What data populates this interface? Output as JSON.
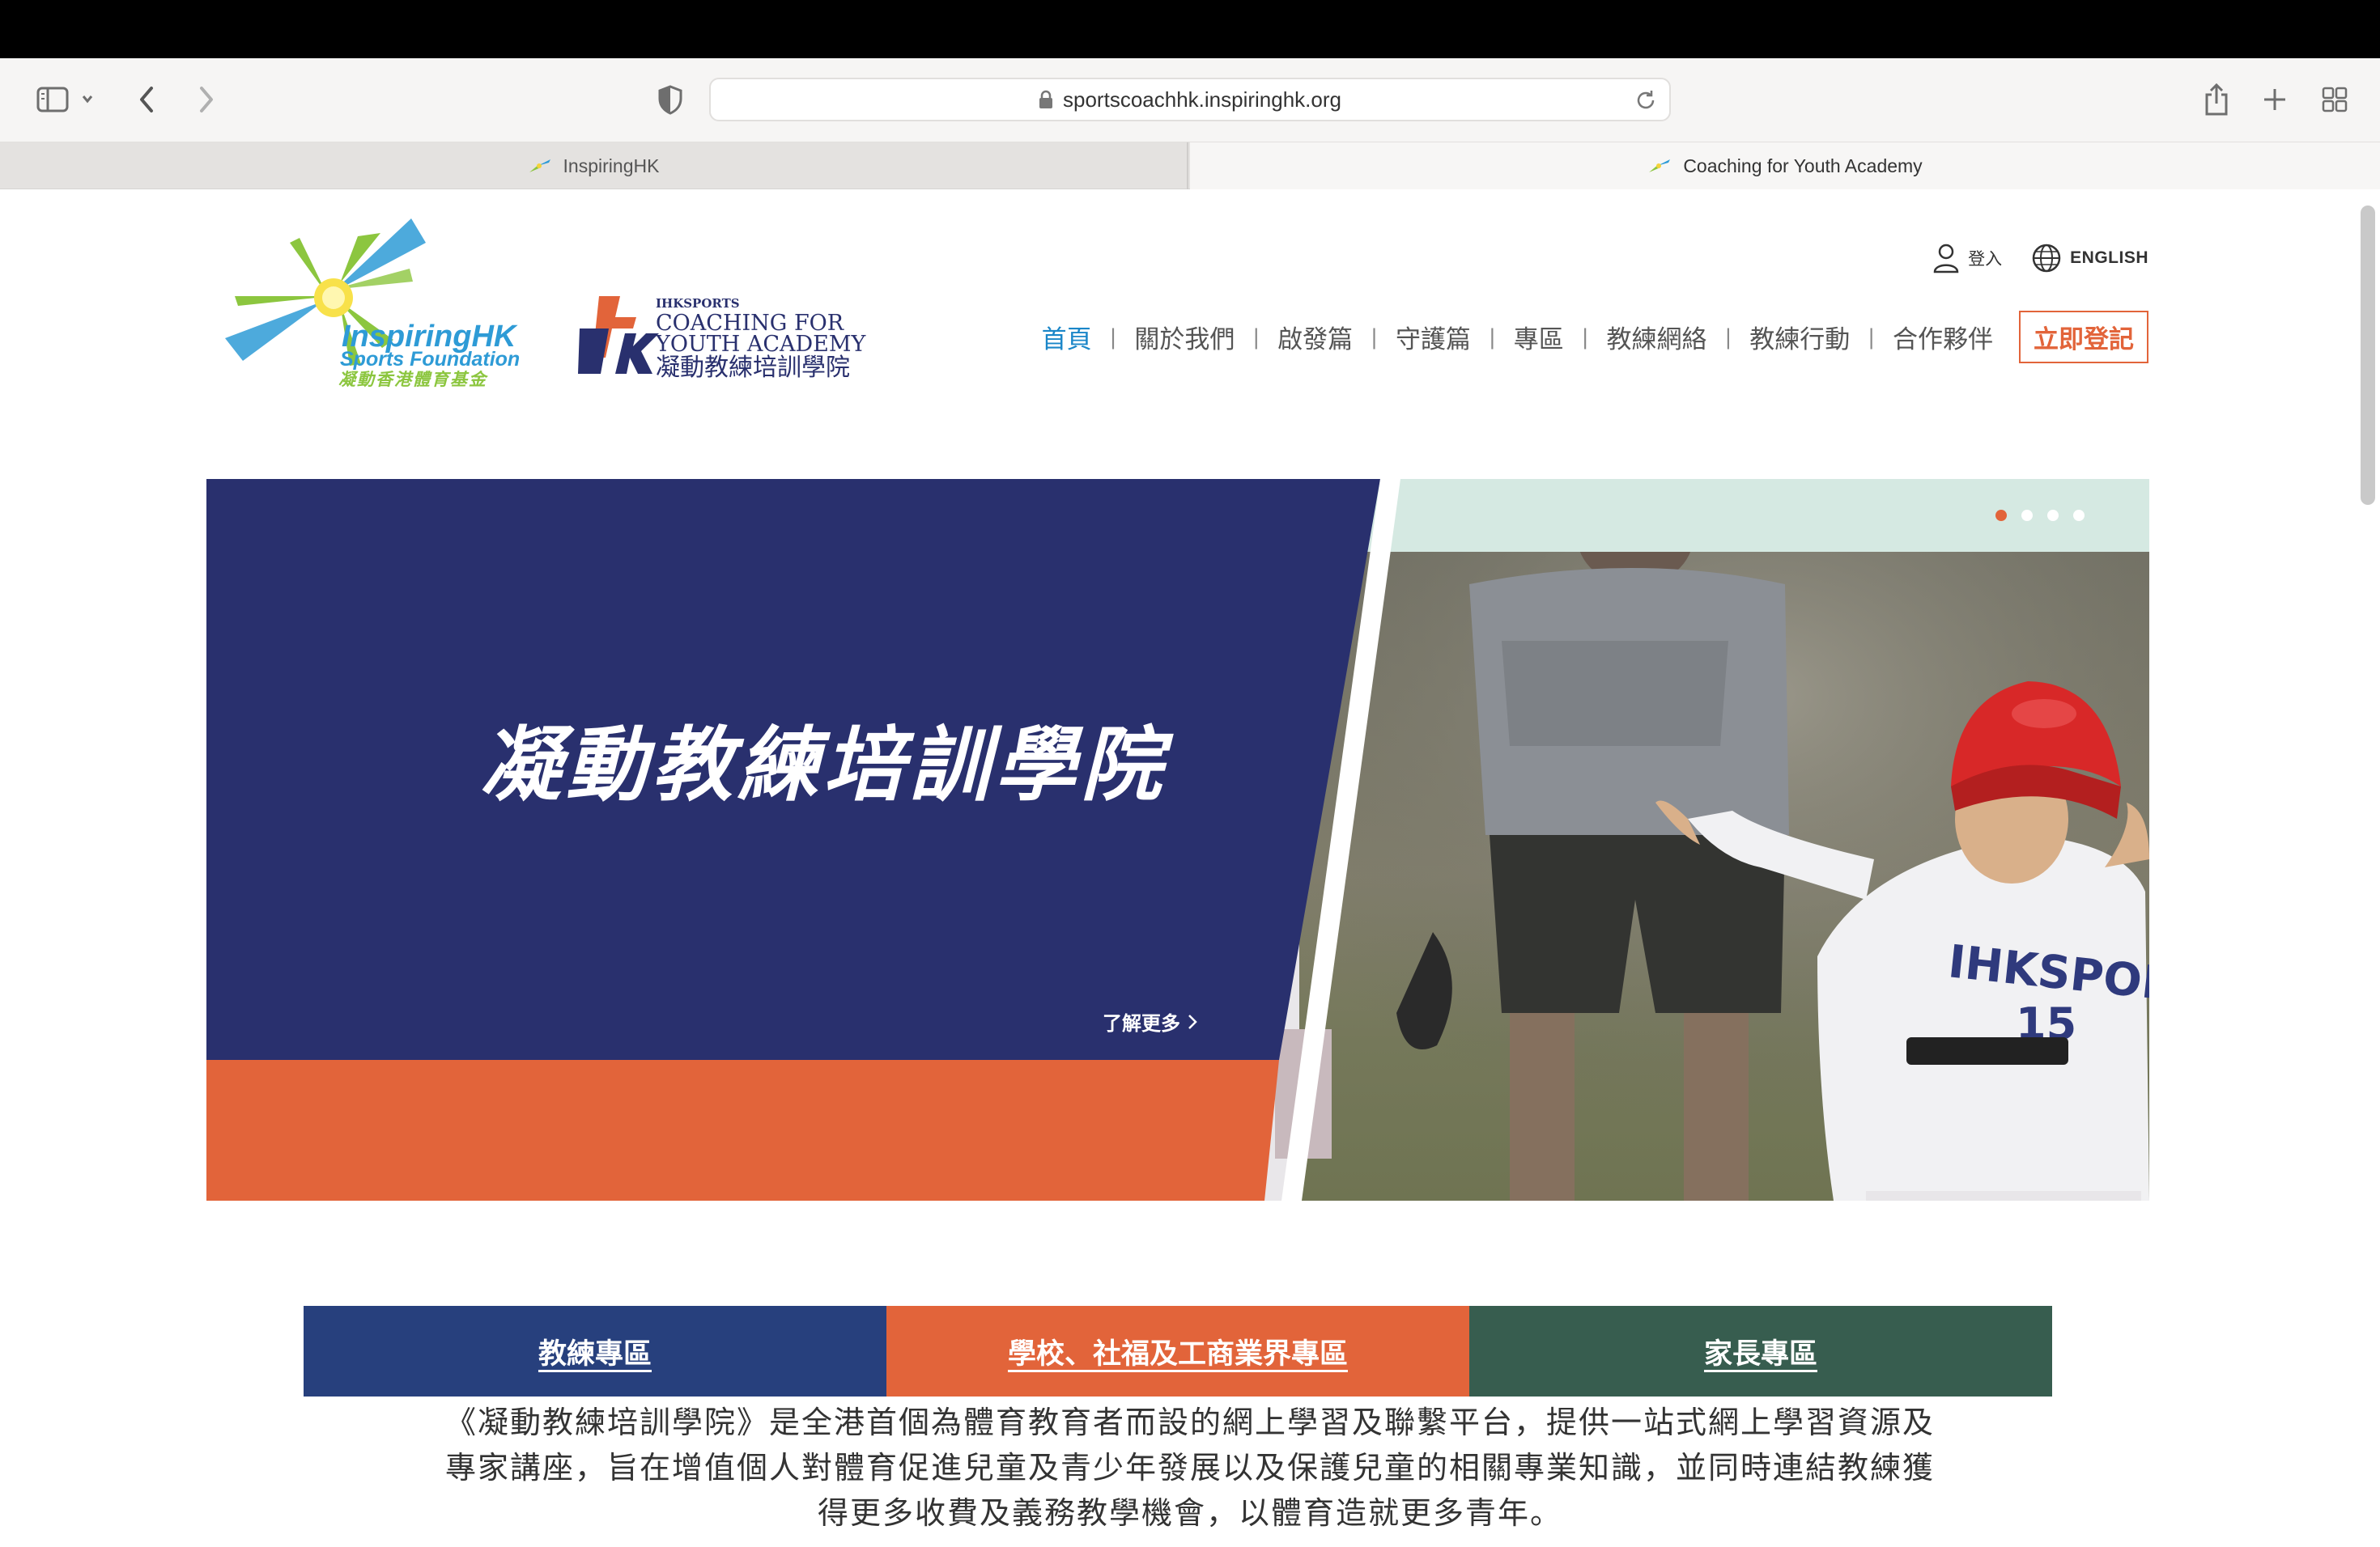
{
  "browser": {
    "url": "sportscoachhk.inspiringhk.org",
    "tabs": [
      {
        "label": "InspiringHK"
      },
      {
        "label": "Coaching for Youth Academy"
      }
    ]
  },
  "header": {
    "logo_ihk": {
      "line1": "InspiringHK",
      "line2": "Sports Foundation",
      "line3": "凝動香港體育基金"
    },
    "logo_cya": {
      "small": "IHKSPORTS",
      "line1": "COACHING FOR",
      "line2": "YOUTH ACADEMY",
      "line3": "凝動教練培訓學院"
    },
    "login_label": "登入",
    "language_label": "ENGLISH",
    "nav": [
      {
        "label": "首頁"
      },
      {
        "label": "關於我們"
      },
      {
        "label": "啟發篇"
      },
      {
        "label": "守護篇"
      },
      {
        "label": "專區"
      },
      {
        "label": "教練網絡"
      },
      {
        "label": "教練行動"
      },
      {
        "label": "合作夥伴"
      }
    ],
    "register_label": "立即登記"
  },
  "hero": {
    "title": "凝動教練培訓學院",
    "learn_more": "了解更多",
    "jersey_text": "IHKSPORTS",
    "jersey_number": "15",
    "colors": {
      "navy": "#29306e",
      "orange": "#e2643a",
      "mint": "#d5e9e2"
    }
  },
  "zones": [
    {
      "label": "教練專區"
    },
    {
      "label": "學校、社福及工商業界專區"
    },
    {
      "label": "家長專區"
    }
  ],
  "intro": {
    "line1": "《凝動教練培訓學院》是全港首個為體育教育者而設的網上學習及聯繫平台，提供一站式網上學習資源及",
    "line2": "專家講座，旨在增值個人對體育促進兒童及青少年發展以及保護兒童的相關專業知識，並同時連結教練獲",
    "line3": "得更多收費及義務教學機會，以體育造就更多青年。"
  }
}
